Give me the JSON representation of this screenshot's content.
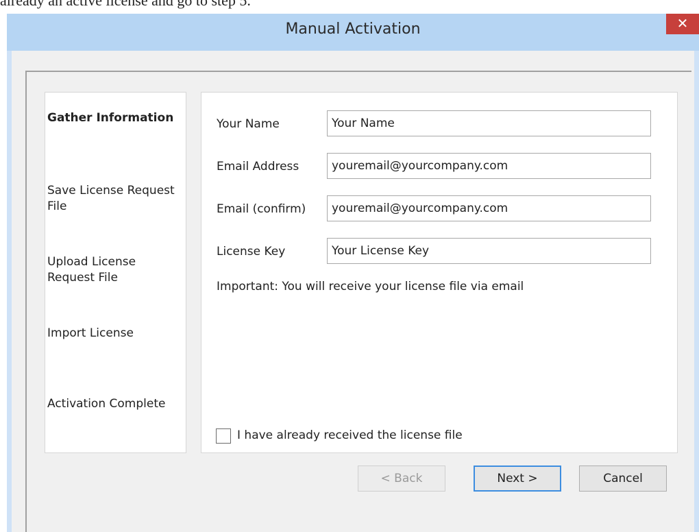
{
  "page": {
    "top_text": "already an active license and go to step 5."
  },
  "window": {
    "title": "Manual Activation",
    "close_glyph": "✕"
  },
  "steps": [
    {
      "label": "Gather Information",
      "active": true
    },
    {
      "label": "Save License Request File",
      "active": false
    },
    {
      "label": "Upload License Request File",
      "active": false
    },
    {
      "label": "Import License",
      "active": false
    },
    {
      "label": "Activation Complete",
      "active": false
    }
  ],
  "form": {
    "fields": [
      {
        "label": "Your Name",
        "value": "Your Name"
      },
      {
        "label": "Email Address",
        "value": "youremail@yourcompany.com"
      },
      {
        "label": "Email (confirm)",
        "value": "youremail@yourcompany.com"
      },
      {
        "label": "License Key",
        "value": "Your License Key"
      }
    ],
    "note": "Important: You will receive your license file via email",
    "checkbox_label": "I have already received the license file",
    "checkbox_checked": false
  },
  "buttons": {
    "back": "< Back",
    "next": "Next >",
    "cancel": "Cancel"
  }
}
